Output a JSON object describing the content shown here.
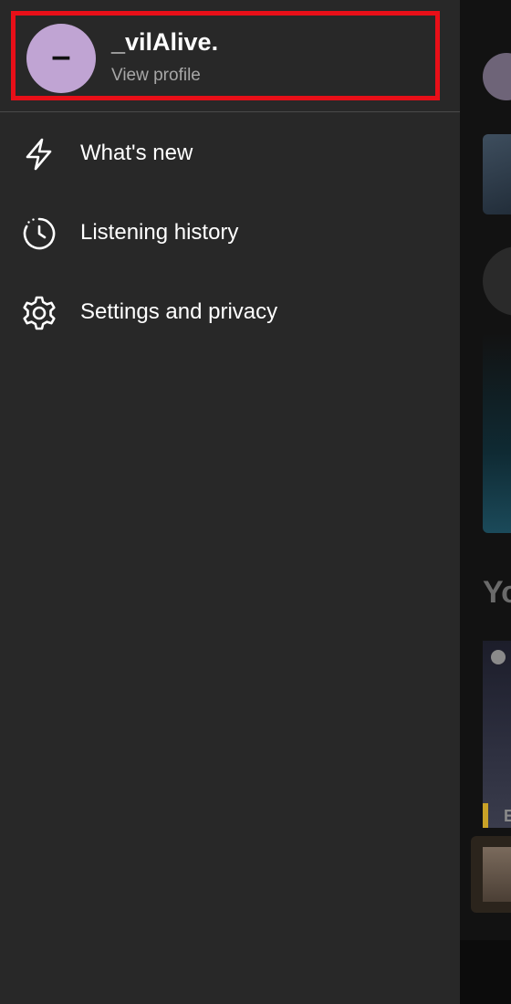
{
  "profile": {
    "avatar_initial": "–",
    "name": "_vilAlive.",
    "subtitle": "View profile"
  },
  "menu": {
    "items": [
      {
        "label": "What's new",
        "icon": "lightning-bolt-icon"
      },
      {
        "label": "Listening history",
        "icon": "clock-history-icon"
      },
      {
        "label": "Settings and privacy",
        "icon": "gear-icon"
      }
    ]
  },
  "background": {
    "section_heading_fragment": "Yo",
    "tile_letter": "E"
  },
  "colors": {
    "drawer_bg": "#282828",
    "avatar_bg": "#c0a4d3",
    "highlight_border": "#e80f18",
    "primary_text": "#ffffff",
    "secondary_text": "#a7a7a7"
  }
}
